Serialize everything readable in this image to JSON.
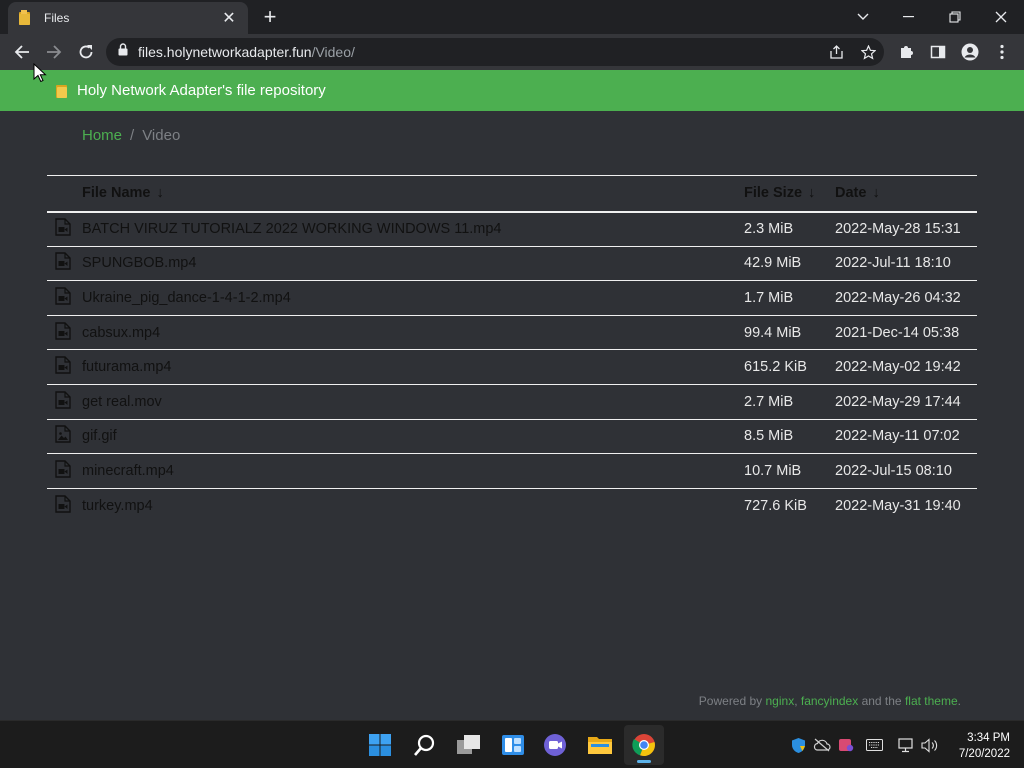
{
  "browser": {
    "tab_title": "Files",
    "tab_close": "✕",
    "new_tab": "+",
    "url_host": "files.holynetworkadapter.fun",
    "url_path": "/Video/"
  },
  "site": {
    "title": "Holy Network Adapter's file repository"
  },
  "breadcrumb": {
    "home": "Home",
    "separator": "/",
    "current": "Video"
  },
  "table": {
    "headers": {
      "name": "File Name",
      "size": "File Size",
      "date": "Date",
      "sort_arrow": "↓"
    },
    "rows": [
      {
        "icon": "video-file-icon",
        "name": "BATCH VIRUZ TUTORIALZ 2022 WORKING WINDOWS 11.mp4",
        "size": "2.3 MiB",
        "date": "2022-May-28 15:31"
      },
      {
        "icon": "video-file-icon",
        "name": "SPUNGBOB.mp4",
        "size": "42.9 MiB",
        "date": "2022-Jul-11 18:10"
      },
      {
        "icon": "video-file-icon",
        "name": "Ukraine_pig_dance-1-4-1-2.mp4",
        "size": "1.7 MiB",
        "date": "2022-May-26 04:32"
      },
      {
        "icon": "video-file-icon",
        "name": "cabsux.mp4",
        "size": "99.4 MiB",
        "date": "2021-Dec-14 05:38"
      },
      {
        "icon": "video-file-icon",
        "name": "futurama.mp4",
        "size": "615.2 KiB",
        "date": "2022-May-02 19:42"
      },
      {
        "icon": "video-file-icon",
        "name": "get real.mov",
        "size": "2.7 MiB",
        "date": "2022-May-29 17:44"
      },
      {
        "icon": "image-file-icon",
        "name": "gif.gif",
        "size": "8.5 MiB",
        "date": "2022-May-11 07:02"
      },
      {
        "icon": "video-file-icon",
        "name": "minecraft.mp4",
        "size": "10.7 MiB",
        "date": "2022-Jul-15 08:10"
      },
      {
        "icon": "video-file-icon",
        "name": "turkey.mp4",
        "size": "727.6 KiB",
        "date": "2022-May-31 19:40"
      }
    ]
  },
  "footer": {
    "prefix": "Powered by ",
    "nginx": "nginx",
    "comma": ", ",
    "fancyindex": "fancyindex",
    "and_the": " and the ",
    "flat_theme": "flat theme",
    "period": "."
  },
  "taskbar": {
    "time": "3:34 PM",
    "date": "7/20/2022"
  },
  "colors": {
    "accent": "#4caf50",
    "page_bg": "#2f3136",
    "browser_frame": "#202124",
    "browser_toolbar": "#35363a"
  }
}
